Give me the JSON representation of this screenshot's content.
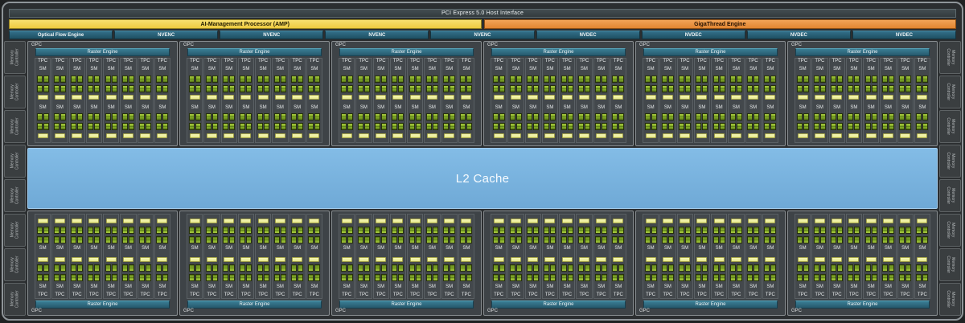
{
  "header": {
    "pci_label": "PCI Express 5.0 Host Interface",
    "amp_label": "AI-Management Processor (AMP)",
    "gigathread_label": "GigaThread Engine"
  },
  "media_engines": [
    {
      "label": "Optical Flow Engine"
    },
    {
      "label": "NVENC"
    },
    {
      "label": "NVENC"
    },
    {
      "label": "NVENC"
    },
    {
      "label": "NVENC"
    },
    {
      "label": "NVDEC"
    },
    {
      "label": "NVDEC"
    },
    {
      "label": "NVDEC"
    },
    {
      "label": "NVDEC"
    }
  ],
  "gpu": {
    "gpc_label": "GPC",
    "raster_label": "Raster Engine",
    "tpc_label": "TPC",
    "sm_label": "SM",
    "l2_label": "L2 Cache",
    "memory_label_line1": "Memory",
    "memory_label_line2": "Controller",
    "counts": {
      "gpc_rows": 2,
      "gpc_per_row": 6,
      "tpc_per_gpc": 8,
      "sm_per_tpc": 2,
      "core_rows_per_sm": 2,
      "cores_per_row": 2,
      "memory_controllers_per_side": 8
    }
  },
  "colors": {
    "amp_yellow": "#eecb40",
    "gigathread_orange": "#e18531",
    "media_teal": "#265e73",
    "raster_teal": "#2e6b80",
    "l2_blue": "#79b3e0",
    "core_green": "#76a01e",
    "sm_cache_yellow": "#eef0a0",
    "die_background": "#2b2e30"
  }
}
